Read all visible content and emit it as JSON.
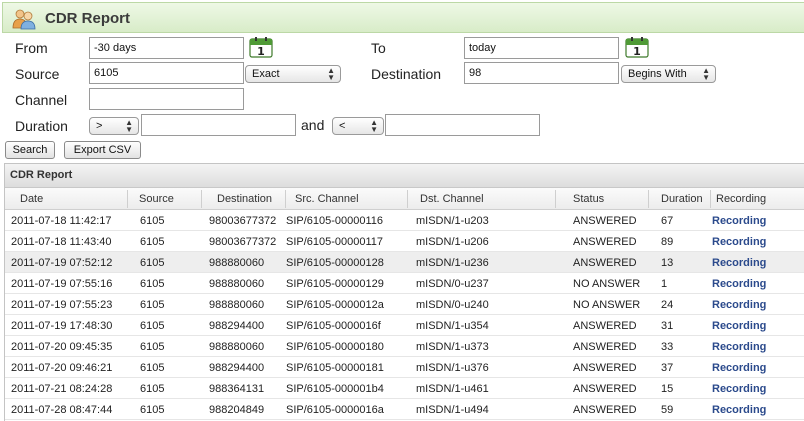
{
  "header": {
    "title": "CDR Report",
    "icon": "users-icon"
  },
  "form": {
    "from_label": "From",
    "from_value": "-30 days",
    "to_label": "To",
    "to_value": "today",
    "source_label": "Source",
    "source_value": "6105",
    "source_mode": "Exact",
    "destination_label": "Destination",
    "destination_value": "98",
    "destination_mode": "Begins With",
    "channel_label": "Channel",
    "channel_value": "",
    "duration_label": "Duration",
    "duration_op1": ">",
    "duration_value1": "",
    "and_label": "and",
    "duration_op2": "<",
    "duration_value2": "",
    "search_button": "Search",
    "export_button": "Export CSV"
  },
  "table": {
    "title": "CDR Report",
    "columns": [
      "Date",
      "Source",
      "Destination",
      "Src. Channel",
      "Dst. Channel",
      "Status",
      "Duration",
      "Recording"
    ],
    "rows": [
      [
        "2011-07-18 11:42:17",
        "6105",
        "98003677372",
        "SIP/6105-00000116",
        "mISDN/1-u203",
        "ANSWERED",
        "67",
        "Recording"
      ],
      [
        "2011-07-18 11:43:40",
        "6105",
        "98003677372",
        "SIP/6105-00000117",
        "mISDN/1-u206",
        "ANSWERED",
        "89",
        "Recording"
      ],
      [
        "2011-07-19 07:52:12",
        "6105",
        "988880060",
        "SIP/6105-00000128",
        "mISDN/1-u236",
        "ANSWERED",
        "13",
        "Recording"
      ],
      [
        "2011-07-19 07:55:16",
        "6105",
        "988880060",
        "SIP/6105-00000129",
        "mISDN/0-u237",
        "NO ANSWER",
        "1",
        "Recording"
      ],
      [
        "2011-07-19 07:55:23",
        "6105",
        "988880060",
        "SIP/6105-0000012a",
        "mISDN/0-u240",
        "NO ANSWER",
        "24",
        "Recording"
      ],
      [
        "2011-07-19 17:48:30",
        "6105",
        "988294400",
        "SIP/6105-0000016f",
        "mISDN/1-u354",
        "ANSWERED",
        "31",
        "Recording"
      ],
      [
        "2011-07-20 09:45:35",
        "6105",
        "988880060",
        "SIP/6105-00000180",
        "mISDN/1-u373",
        "ANSWERED",
        "33",
        "Recording"
      ],
      [
        "2011-07-20 09:46:21",
        "6105",
        "988294400",
        "SIP/6105-00000181",
        "mISDN/1-u376",
        "ANSWERED",
        "37",
        "Recording"
      ],
      [
        "2011-07-21 08:24:28",
        "6105",
        "988364131",
        "SIP/6105-000001b4",
        "mISDN/1-u461",
        "ANSWERED",
        "15",
        "Recording"
      ],
      [
        "2011-07-28 08:47:44",
        "6105",
        "988204849",
        "SIP/6105-0000016a",
        "mISDN/1-u494",
        "ANSWERED",
        "59",
        "Recording"
      ]
    ],
    "selected_row": 2
  },
  "calendar_day": "1",
  "colors": {
    "header_bg": "#d8ecc8",
    "link": "#2b4a8c"
  }
}
